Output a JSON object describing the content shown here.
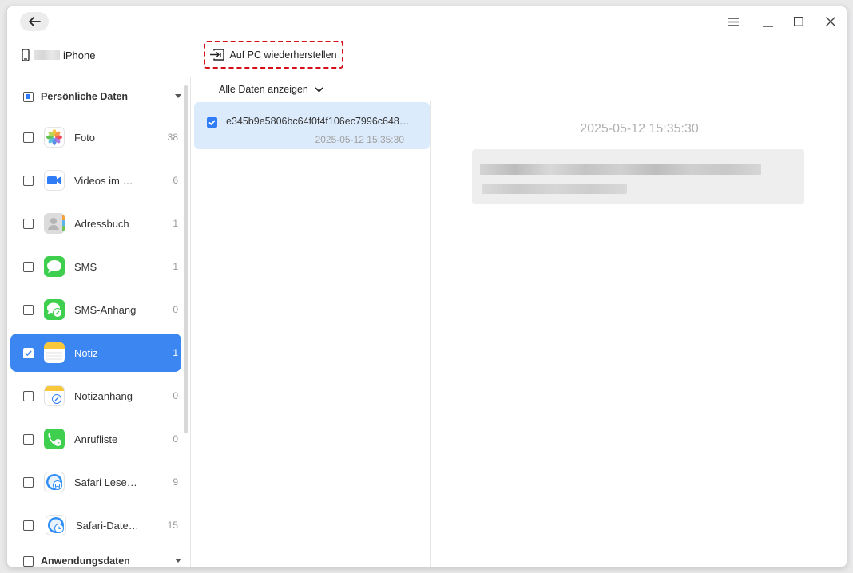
{
  "device": {
    "name": "iPhone"
  },
  "toolbar": {
    "restore_label": "Auf PC wiederherstellen"
  },
  "sidebar": {
    "personal_section": "Persönliche Daten",
    "app_section": "Anwendungsdaten",
    "items": [
      {
        "label": "Foto",
        "count": "38",
        "icon": "photos-icon"
      },
      {
        "label": "Videos im …",
        "count": "6",
        "icon": "video-icon"
      },
      {
        "label": "Adressbuch",
        "count": "1",
        "icon": "contacts-icon"
      },
      {
        "label": "SMS",
        "count": "1",
        "icon": "messages-icon"
      },
      {
        "label": "SMS-Anhang",
        "count": "0",
        "icon": "message-attachment-icon"
      },
      {
        "label": "Notiz",
        "count": "1",
        "icon": "notes-icon",
        "selected": true
      },
      {
        "label": "Notizanhang",
        "count": "0",
        "icon": "note-attachment-icon"
      },
      {
        "label": "Anrufliste",
        "count": "0",
        "icon": "call-history-icon"
      },
      {
        "label": "Safari Lese…",
        "count": "9",
        "icon": "safari-reading-icon"
      },
      {
        "label": "Safari-Date…",
        "count": "15",
        "icon": "safari-history-icon"
      }
    ]
  },
  "filter": {
    "label": "Alle Daten anzeigen"
  },
  "notes": [
    {
      "title": "e345b9e5806bc64f0f4f106ec7996c648…",
      "date": "2025-05-12 15:35:30",
      "checked": true
    }
  ],
  "detail": {
    "date": "2025-05-12 15:35:30"
  },
  "colors": {
    "accent": "#3b86f1",
    "highlight_border": "#d4101b",
    "selected_note_bg": "#dcebfc"
  }
}
